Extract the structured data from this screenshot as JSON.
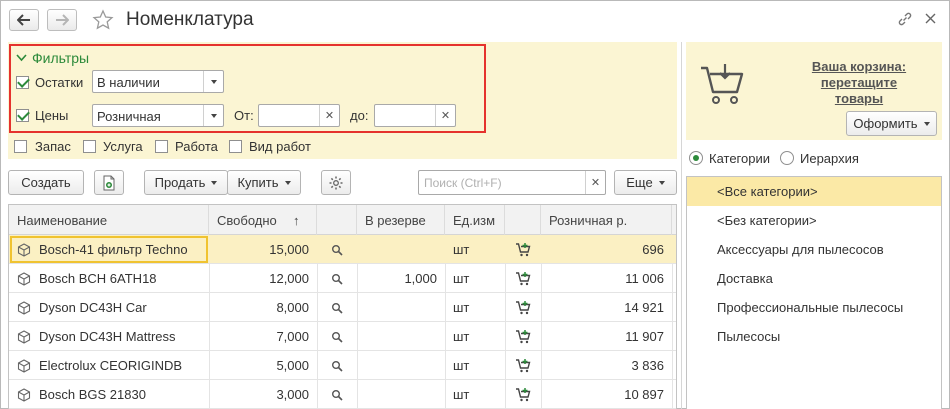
{
  "window": {
    "title": "Номенклатура"
  },
  "filters": {
    "title": "Фильтры",
    "stock": {
      "label": "Остатки",
      "checked": true,
      "value": "В наличии"
    },
    "prices": {
      "label": "Цены",
      "checked": true,
      "value": "Розничная",
      "from_label": "От:",
      "from_value": "",
      "to_label": "до:",
      "to_value": ""
    },
    "types": [
      {
        "label": "Запас",
        "checked": false
      },
      {
        "label": "Услуга",
        "checked": false
      },
      {
        "label": "Работа",
        "checked": false
      },
      {
        "label": "Вид работ",
        "checked": false
      }
    ]
  },
  "toolbar": {
    "create": "Создать",
    "sell": "Продать",
    "buy": "Купить",
    "search_placeholder": "Поиск (Ctrl+F)",
    "more": "Еще"
  },
  "table": {
    "columns": [
      "Наименование",
      "Свободно",
      "",
      "В резерве",
      "Ед.изм",
      "",
      "Розничная р."
    ],
    "sort_indicator": "↑",
    "rows": [
      {
        "name": "Bosch-41 фильтр Techno",
        "free": "15,000",
        "reserve": "",
        "unit": "шт",
        "price": "696",
        "selected": true
      },
      {
        "name": "Bosch BCH 6ATH18",
        "free": "12,000",
        "reserve": "1,000",
        "unit": "шт",
        "price": "11 006"
      },
      {
        "name": "Dyson DC43H Car",
        "free": "8,000",
        "reserve": "",
        "unit": "шт",
        "price": "14 921"
      },
      {
        "name": "Dyson DC43H Mattress",
        "free": "7,000",
        "reserve": "",
        "unit": "шт",
        "price": "11 907"
      },
      {
        "name": "Electrolux CEORIGINDB",
        "free": "5,000",
        "reserve": "",
        "unit": "шт",
        "price": "3 836"
      },
      {
        "name": "Bosch BGS 21830",
        "free": "3,000",
        "reserve": "",
        "unit": "шт",
        "price": "10 897"
      }
    ]
  },
  "basket": {
    "text_line1": "Ваша корзина:",
    "text_line2": "перетащите товары",
    "checkout": "Оформить"
  },
  "view_mode": {
    "categories": "Категории",
    "hierarchy": "Иерархия",
    "selected": "categories"
  },
  "categories": [
    "<Все категории>",
    "<Без категории>",
    "Аксессуары для пылесосов",
    "Доставка",
    "Профессиональные пылесосы",
    "Пылесосы"
  ],
  "colors": {
    "accent_green": "#2c8a3a",
    "filter_border": "#e5322d",
    "panel_yellow": "#fbf5d3",
    "selection": "#fbf0c3"
  }
}
